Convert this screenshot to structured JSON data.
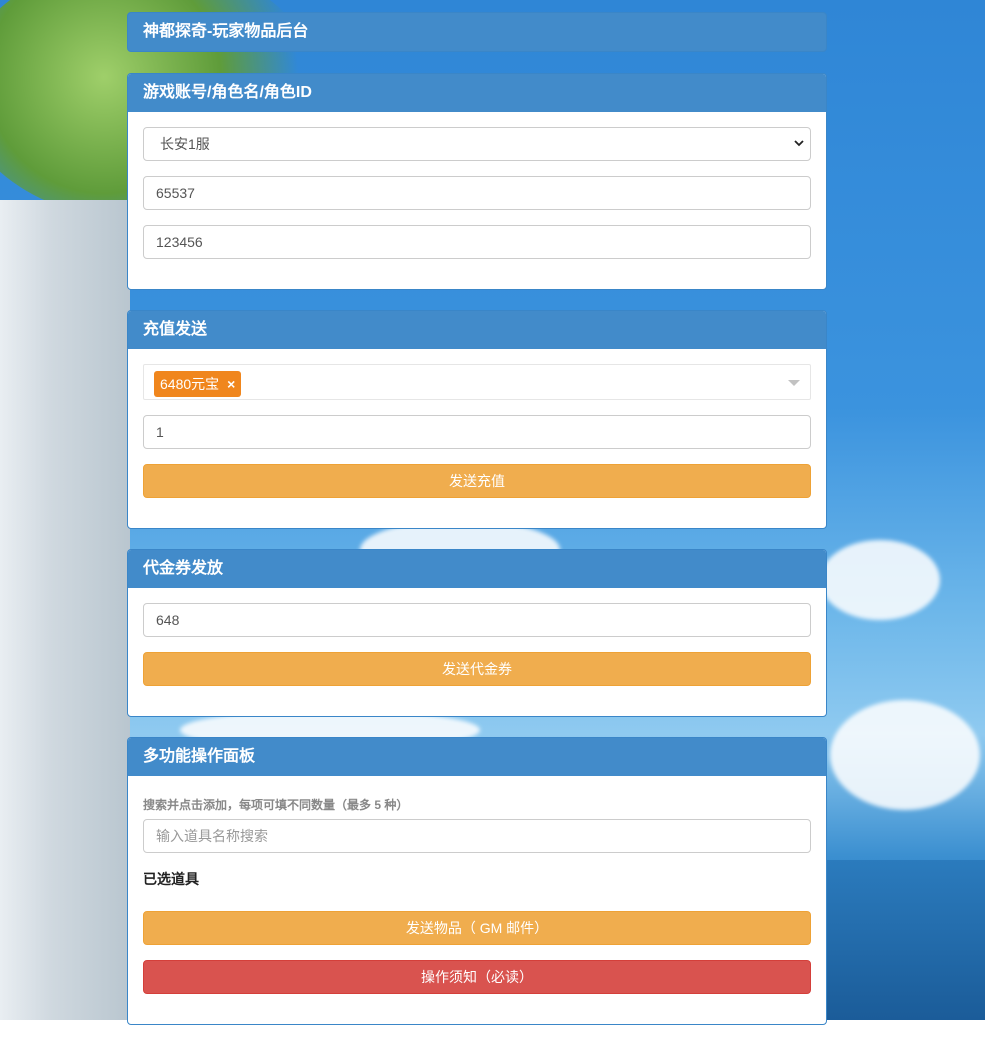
{
  "header": {
    "title": "神都探奇-玩家物品后台"
  },
  "account_panel": {
    "title": "游戏账号/角色名/角色ID",
    "server_select": "长安1服",
    "account_value": "65537",
    "role_id_value": "123456"
  },
  "recharge_panel": {
    "title": "充值发送",
    "selected_tag": "6480元宝",
    "tag_remove": "×",
    "quantity_value": "1",
    "send_button": "发送充值"
  },
  "voucher_panel": {
    "title": "代金券发放",
    "amount_value": "648",
    "send_button": "发送代金券"
  },
  "multi_panel": {
    "title": "多功能操作面板",
    "hint": "搜索并点击添加，每项可填不同数量（最多 5 种）",
    "search_placeholder": "输入道具名称搜索",
    "selected_label": "已选道具",
    "send_items_button": "发送物品（ GM 邮件）",
    "notice_button": "操作须知（必读）"
  },
  "colors": {
    "panel_header": "#428bca",
    "warning_button": "#f0ad4e",
    "danger_button": "#d9534f",
    "tag": "#f0861d"
  }
}
